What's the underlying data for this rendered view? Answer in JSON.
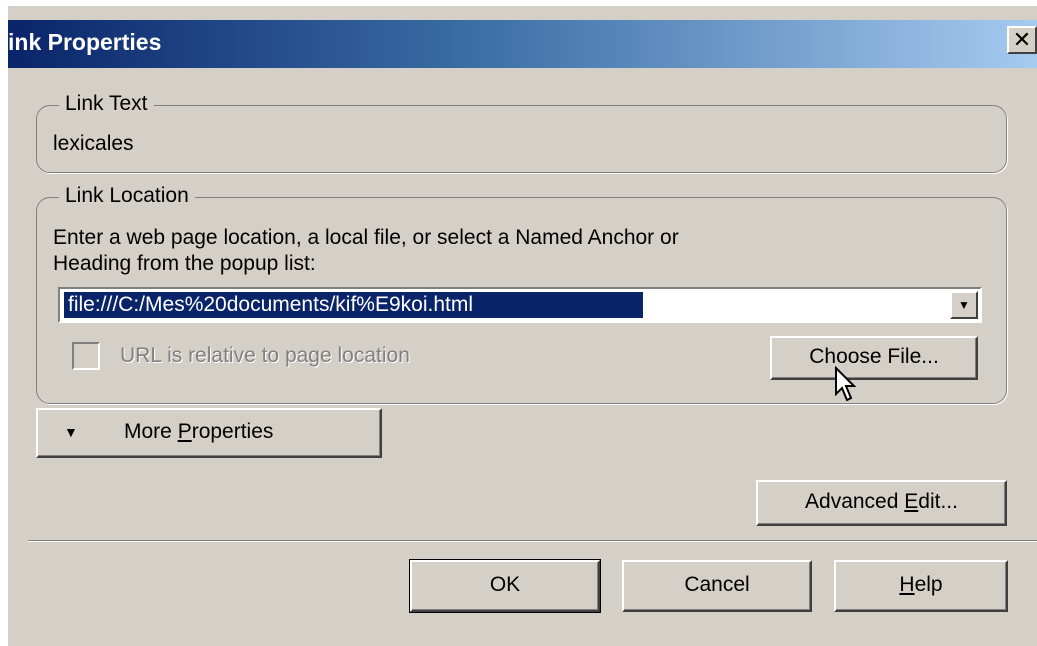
{
  "window": {
    "title": "ink Properties",
    "close_icon": "close-icon"
  },
  "link_text_group": {
    "legend": "Link Text",
    "value": "lexicales"
  },
  "link_location_group": {
    "legend": "Link Location",
    "instructions_line1": "Enter a web page location, a local file, or select a Named Anchor or",
    "instructions_line2": "Heading from the popup list:",
    "url_value": "file:///C:/Mes%20documents/kif%E9koi.html",
    "relative_checkbox_label": "URL is relative to page location",
    "relative_checked": false,
    "choose_file_label": "Choose File..."
  },
  "buttons": {
    "more_properties_prefix": "More ",
    "more_properties_accel": "P",
    "more_properties_rest": "roperties",
    "advanced_edit_prefix": "Advanced ",
    "advanced_edit_accel": "E",
    "advanced_edit_rest": "dit...",
    "ok": "OK",
    "cancel": "Cancel",
    "help_accel": "H",
    "help_rest": "elp"
  },
  "colors": {
    "dialog_bg": "#d4d0c8",
    "title_gradient_start": "#0a246a",
    "title_gradient_end": "#a6caf0",
    "selection_bg": "#0a246a"
  }
}
